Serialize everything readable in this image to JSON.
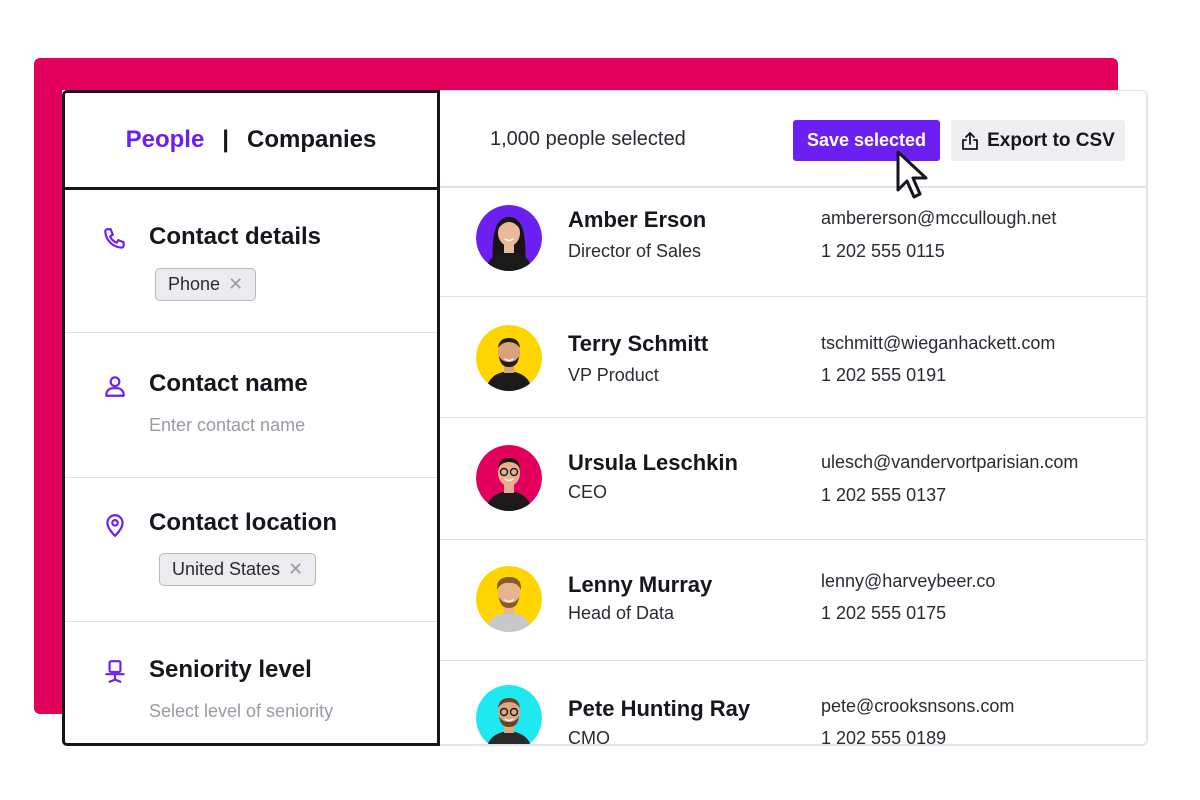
{
  "tabs": {
    "people": "People",
    "separator": "|",
    "companies": "Companies"
  },
  "filters": [
    {
      "title": "Contact details",
      "icon": "phone-icon",
      "chip": "Phone"
    },
    {
      "title": "Contact name",
      "icon": "person-icon",
      "hint": "Enter contact name"
    },
    {
      "title": "Contact location",
      "icon": "location-pin-icon",
      "chip": "United States"
    },
    {
      "title": "Seniority level",
      "icon": "chair-icon",
      "hint": "Select level of seniority"
    }
  ],
  "toolbar": {
    "selected_count": "1,000 people selected",
    "save_label": "Save selected",
    "export_label": "Export to CSV"
  },
  "colors": {
    "accent": "#6b1ff0",
    "brand_magenta": "#e3005d"
  },
  "people": [
    {
      "name": "Amber Erson",
      "title": "Director of Sales",
      "email": "ambererson@mccullough.net",
      "phone": "1 202 555 0115",
      "avatar_color": "#6b1ff0"
    },
    {
      "name": "Terry Schmitt",
      "title": "VP Product",
      "email": "tschmitt@wieganhackett.com",
      "phone": "1 202 555 0191",
      "avatar_color": "#ffd500"
    },
    {
      "name": "Ursula Leschkin",
      "title": "CEO",
      "email": "ulesch@vandervortparisian.com",
      "phone": "1 202 555 0137",
      "avatar_color": "#e3005d"
    },
    {
      "name": "Lenny Murray",
      "title": "Head of Data",
      "email": "lenny@harveybeer.co",
      "phone": "1 202 555 0175",
      "avatar_color": "#ffd500"
    },
    {
      "name": "Pete Hunting Ray",
      "title": "CMO",
      "email": "pete@crooksnsons.com",
      "phone": "1 202 555 0189",
      "avatar_color": "#1ee8f0"
    }
  ]
}
